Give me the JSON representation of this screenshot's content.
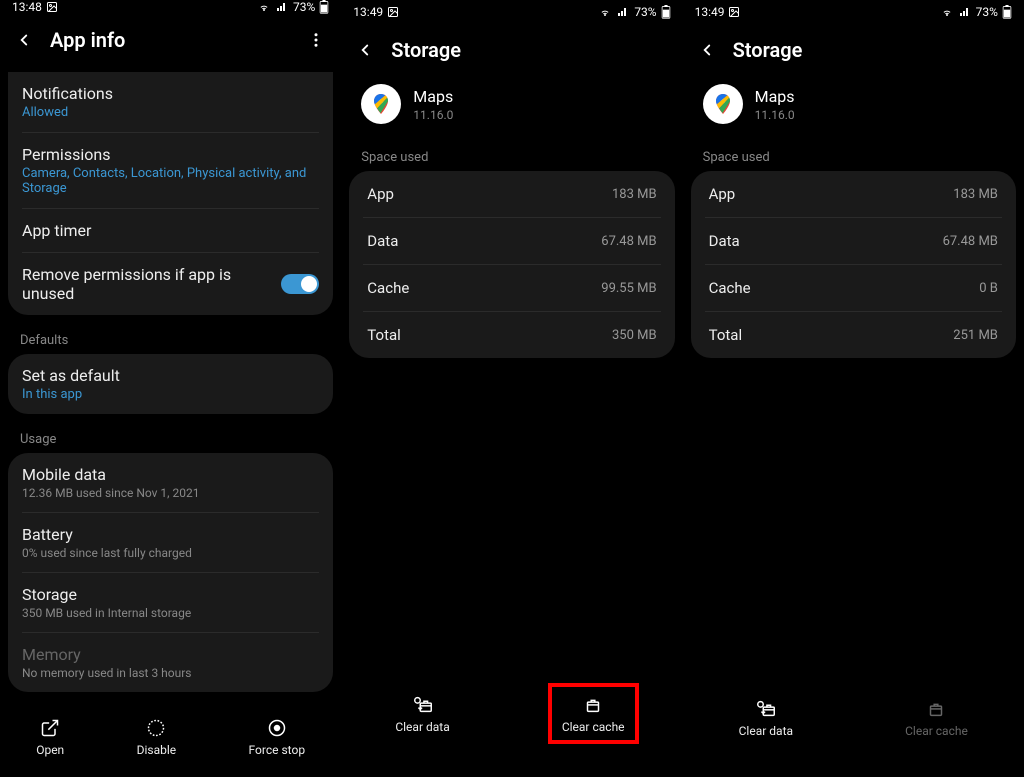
{
  "screen1": {
    "status": {
      "time": "13:48",
      "battery": "73%"
    },
    "header": {
      "title": "App info"
    },
    "card1": [
      {
        "label": "Notifications",
        "sub": "Allowed",
        "sub_kind": "blue"
      },
      {
        "label": "Permissions",
        "sub": "Camera, Contacts, Location, Physical activity, and Storage",
        "sub_kind": "blue"
      },
      {
        "label": "App timer"
      },
      {
        "label": "Remove permissions if app is unused",
        "toggle": true
      }
    ],
    "defaults_label": "Defaults",
    "card2": [
      {
        "label": "Set as default",
        "sub": "In this app",
        "sub_kind": "blue"
      }
    ],
    "usage_label": "Usage",
    "card3": [
      {
        "label": "Mobile data",
        "sub": "12.36 MB used since Nov 1, 2021",
        "sub_kind": "gray"
      },
      {
        "label": "Battery",
        "sub": "0% used since last fully charged",
        "sub_kind": "gray"
      },
      {
        "label": "Storage",
        "sub": "350 MB used in Internal storage",
        "sub_kind": "gray"
      },
      {
        "label": "Memory",
        "sub": "No memory used in last 3 hours",
        "sub_kind": "gray",
        "disabled": true
      }
    ],
    "bottom": {
      "open": "Open",
      "disable": "Disable",
      "force": "Force stop"
    }
  },
  "screen2": {
    "status": {
      "time": "13:49",
      "battery": "73%"
    },
    "header": {
      "title": "Storage"
    },
    "app": {
      "name": "Maps",
      "version": "11.16.0"
    },
    "space_label": "Space used",
    "rows": [
      {
        "k": "App",
        "v": "183 MB"
      },
      {
        "k": "Data",
        "v": "67.48 MB"
      },
      {
        "k": "Cache",
        "v": "99.55 MB"
      },
      {
        "k": "Total",
        "v": "350 MB"
      }
    ],
    "bottom": {
      "clear_data": "Clear data",
      "clear_cache": "Clear cache"
    },
    "highlight": "clear_cache"
  },
  "screen3": {
    "status": {
      "time": "13:49",
      "battery": "73%"
    },
    "header": {
      "title": "Storage"
    },
    "app": {
      "name": "Maps",
      "version": "11.16.0"
    },
    "space_label": "Space used",
    "rows": [
      {
        "k": "App",
        "v": "183 MB"
      },
      {
        "k": "Data",
        "v": "67.48 MB"
      },
      {
        "k": "Cache",
        "v": "0 B"
      },
      {
        "k": "Total",
        "v": "251 MB"
      }
    ],
    "bottom": {
      "clear_data": "Clear data",
      "clear_cache": "Clear cache"
    },
    "clear_cache_disabled": true
  }
}
